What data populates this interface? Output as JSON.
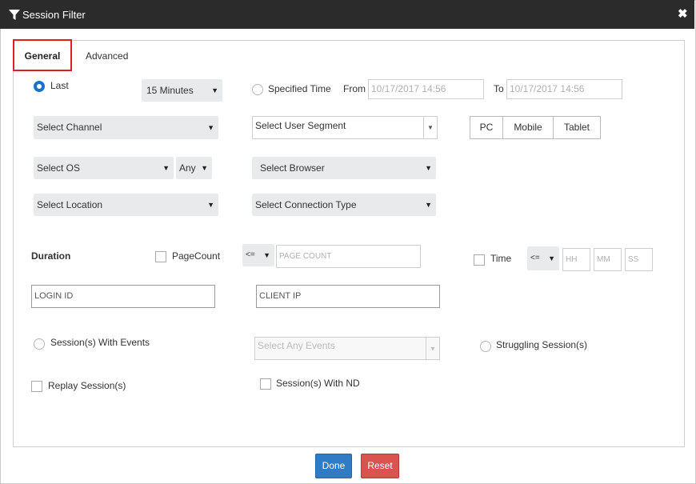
{
  "window": {
    "title": "Session Filter",
    "close_symbol": "✖"
  },
  "tabs": [
    {
      "label": "General",
      "active": true
    },
    {
      "label": "Advanced",
      "active": false
    }
  ],
  "time": {
    "last_label": "Last",
    "last_value": "15 Minutes",
    "specified_label": "Specified Time",
    "from_label": "From",
    "from_placeholder": "10/17/2017 14:56",
    "to_label": "To",
    "to_placeholder": "10/17/2017 14:56"
  },
  "filters": {
    "channel": "Select Channel",
    "user_segment": "Select User Segment",
    "device_buttons": [
      "PC",
      "Mobile",
      "Tablet"
    ],
    "os": "Select OS",
    "os_version": "Any",
    "browser": "Select Browser",
    "location": "Select Location",
    "connection_type": "Select Connection Type"
  },
  "duration": {
    "label": "Duration",
    "pagecount_label": "PageCount",
    "pagecount_operator": "<=",
    "pagecount_placeholder": "PAGE COUNT",
    "time_label": "Time",
    "time_operator": "<=",
    "hh_placeholder": "HH",
    "mm_placeholder": "MM",
    "ss_placeholder": "SS"
  },
  "ids": {
    "login_placeholder": "LOGIN ID",
    "client_ip_placeholder": "CLIENT IP"
  },
  "options": {
    "with_events_label": "Session(s) With Events",
    "events_placeholder": "Select Any Events",
    "struggling_label": "Struggling Session(s)",
    "replay_label": "Replay Session(s)",
    "with_nd_label": "Session(s) With ND"
  },
  "actions": {
    "done_label": "Done",
    "reset_label": "Reset"
  },
  "colors": {
    "titlebar": "#2b2b2b",
    "accent": "#1a73c8",
    "tab_highlight": "#e02020",
    "done": "#2f7bc4",
    "reset": "#d9534f"
  }
}
